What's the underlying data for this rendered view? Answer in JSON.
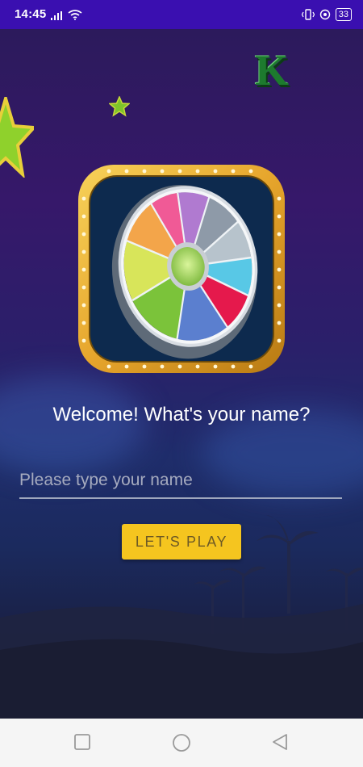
{
  "status_bar": {
    "time": "14:45",
    "battery": "33",
    "icons": [
      "signal-icon",
      "wifi-icon",
      "vibrate-icon",
      "alarm-icon",
      "battery-icon"
    ]
  },
  "welcome": {
    "title": "Welcome! What's your name?",
    "name_placeholder": "Please type your name",
    "name_value": "",
    "play_label": "LET'S PLAY"
  },
  "decor": {
    "letter_k": "K"
  },
  "colors": {
    "status_bar": "#3a0fb0",
    "button": "#f5c51f",
    "button_text": "#6e5a25",
    "frame_gold": "#e6a52c"
  },
  "nav_bar": {
    "icons": [
      "recents-icon",
      "home-icon",
      "back-icon"
    ]
  }
}
